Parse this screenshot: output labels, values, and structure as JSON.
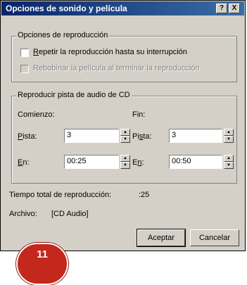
{
  "window": {
    "title": "Opciones de sonido y película",
    "help_button": "?",
    "close_button": "X"
  },
  "playback_options": {
    "legend": "Opciones de reproducción",
    "repeat_label_accel": "R",
    "repeat_label_rest": "epetir la reproducción hasta su interrupción",
    "rewind_label": "Rebobinar la película al terminar la reproducción"
  },
  "cd_track": {
    "legend": "Reproducir pista de audio de CD",
    "start_label": "Comienzo:",
    "end_label": "Fin:",
    "start_track_accel": "P",
    "start_track_rest": "ista:",
    "start_track_value": "3",
    "start_time_accel": "E",
    "start_time_rest": "n:",
    "start_time_value": "00:25",
    "end_track_label_a": "Pi",
    "end_track_accel": "s",
    "end_track_label_b": "ta:",
    "end_track_value": "3",
    "end_time_label_a": "E",
    "end_time_accel": "n",
    "end_time_label_b": ":",
    "end_time_value": "00:50"
  },
  "total_time": {
    "label": "Tiempo total de reproducción:",
    "value": ":25"
  },
  "file": {
    "label": "Archivo:",
    "value": "[CD Audio]"
  },
  "buttons": {
    "ok": "Aceptar",
    "cancel": "Cancelar"
  },
  "badge": {
    "number": "11",
    "color": "#c4271c"
  }
}
